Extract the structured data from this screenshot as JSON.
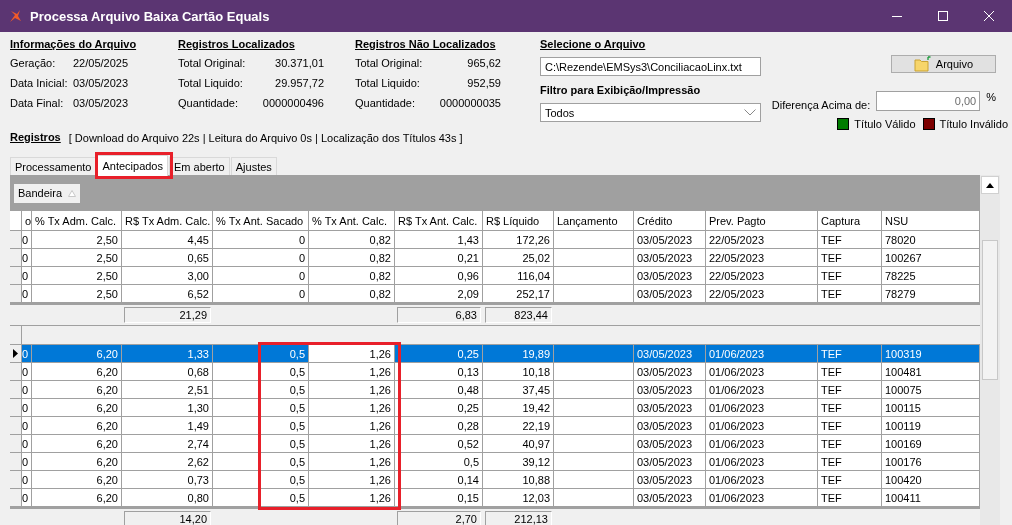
{
  "window": {
    "title": "Processa Arquivo Baixa Cartão Equals"
  },
  "file_info": {
    "heading": "Informações do Arquivo",
    "fields": [
      {
        "label": "Geração:",
        "value": "22/05/2025"
      },
      {
        "label": "Data Inicial:",
        "value": "03/05/2023"
      },
      {
        "label": "Data Final:",
        "value": "03/05/2023"
      }
    ]
  },
  "located": {
    "heading": "Registros Localizados",
    "fields": [
      {
        "label": "Total Original:",
        "value": "30.371,01"
      },
      {
        "label": "Total Liquido:",
        "value": "29.957,72"
      },
      {
        "label": "Quantidade:",
        "value": "0000000496"
      }
    ]
  },
  "not_located": {
    "heading": "Registros Não Localizados",
    "fields": [
      {
        "label": "Total Original:",
        "value": "965,62"
      },
      {
        "label": "Total Liquido:",
        "value": "952,59"
      },
      {
        "label": "Quantidade:",
        "value": "0000000035"
      }
    ]
  },
  "file_select": {
    "heading": "Selecione o Arquivo",
    "path": "C:\\Rezende\\EMSys3\\ConciliacaoLinx.txt",
    "button": "Arquivo"
  },
  "filter": {
    "heading": "Filtro para Exibição/Impressão",
    "value": "Todos"
  },
  "difference": {
    "label": "Diferença Acima de:",
    "value": "0,00",
    "unit": "%"
  },
  "legend": [
    {
      "label": "Título Válido",
      "color": "#007c00"
    },
    {
      "label": "Título Inválido",
      "color": "#7c0000"
    }
  ],
  "records": {
    "heading": "Registros",
    "timing": "[ Download do Arquivo 22s | Leitura do Arquivo 0s | Localização dos Títulos 43s ]"
  },
  "tabs": [
    {
      "label": "Processamento",
      "selected": false,
      "highlighted": false
    },
    {
      "label": "Antecipados",
      "selected": true,
      "highlighted": true
    },
    {
      "label": "Em aberto",
      "selected": false,
      "highlighted": false
    },
    {
      "label": "Ajustes",
      "selected": false,
      "highlighted": false
    }
  ],
  "group_by": {
    "label": "Bandeira"
  },
  "table": {
    "columns": [
      {
        "label": "o",
        "highlighted": false,
        "focused": false
      },
      {
        "label": "% Tx Adm. Calc.",
        "highlighted": false,
        "focused": false
      },
      {
        "label": "R$ Tx Adm. Calc.",
        "highlighted": false,
        "focused": false
      },
      {
        "label": "% Tx Ant. Sacado",
        "highlighted": true,
        "focused": false
      },
      {
        "label": "% Tx Ant. Calc.",
        "highlighted": true,
        "focused": true
      },
      {
        "label": "R$ Tx Ant. Calc.",
        "highlighted": false,
        "focused": false
      },
      {
        "label": "R$ Líquido",
        "highlighted": false,
        "focused": false
      },
      {
        "label": "Lançamento",
        "highlighted": false,
        "focused": false
      },
      {
        "label": "Crédito",
        "highlighted": false,
        "focused": false
      },
      {
        "label": "Prev. Pagto",
        "highlighted": false,
        "focused": false
      },
      {
        "label": "Captura",
        "highlighted": false,
        "focused": false
      },
      {
        "label": "NSU",
        "highlighted": false,
        "focused": false
      }
    ],
    "groups": [
      {
        "highlighted": false,
        "rows": [
          {
            "selected": false,
            "cells": {
              "column_0": "0",
              "column_1": "2,50",
              "column_2": "4,45",
              "column_3": "0",
              "column_4": "0,82",
              "column_5": "1,43",
              "column_6": "172,26",
              "column_8": "03/05/2023",
              "column_9": "22/05/2023",
              "column_10": "TEF",
              "column_11": "78020"
            }
          },
          {
            "selected": false,
            "cells": {
              "column_0": "0",
              "column_1": "2,50",
              "column_2": "0,65",
              "column_3": "0",
              "column_4": "0,82",
              "column_5": "0,21",
              "column_6": "25,02",
              "column_8": "03/05/2023",
              "column_9": "22/05/2023",
              "column_10": "TEF",
              "column_11": "100267"
            }
          },
          {
            "selected": false,
            "cells": {
              "column_0": "0",
              "column_1": "2,50",
              "column_2": "3,00",
              "column_3": "0",
              "column_4": "0,82",
              "column_5": "0,96",
              "column_6": "116,04",
              "column_8": "03/05/2023",
              "column_9": "22/05/2023",
              "column_10": "TEF",
              "column_11": "78225"
            }
          },
          {
            "selected": false,
            "cells": {
              "column_0": "0",
              "column_1": "2,50",
              "column_2": "6,52",
              "column_3": "0",
              "column_4": "0,82",
              "column_5": "2,09",
              "column_6": "252,17",
              "column_8": "03/05/2023",
              "column_9": "22/05/2023",
              "column_10": "TEF",
              "column_11": "78279"
            }
          }
        ],
        "totals": {
          "column_2": "21,29",
          "column_5": "6,83",
          "column_6": "823,44"
        }
      },
      {
        "highlighted": true,
        "rows": [
          {
            "selected": true,
            "cells": {
              "column_0": "0",
              "column_1": "6,20",
              "column_2": "1,33",
              "column_3": "0,5",
              "column_4": "1,26",
              "column_5": "0,25",
              "column_6": "19,89",
              "column_8": "03/05/2023",
              "column_9": "01/06/2023",
              "column_10": "TEF",
              "column_11": "100319"
            }
          },
          {
            "selected": false,
            "cells": {
              "column_0": "0",
              "column_1": "6,20",
              "column_2": "0,68",
              "column_3": "0,5",
              "column_4": "1,26",
              "column_5": "0,13",
              "column_6": "10,18",
              "column_8": "03/05/2023",
              "column_9": "01/06/2023",
              "column_10": "TEF",
              "column_11": "100481"
            }
          },
          {
            "selected": false,
            "cells": {
              "column_0": "0",
              "column_1": "6,20",
              "column_2": "2,51",
              "column_3": "0,5",
              "column_4": "1,26",
              "column_5": "0,48",
              "column_6": "37,45",
              "column_8": "03/05/2023",
              "column_9": "01/06/2023",
              "column_10": "TEF",
              "column_11": "100075"
            }
          },
          {
            "selected": false,
            "cells": {
              "column_0": "0",
              "column_1": "6,20",
              "column_2": "1,30",
              "column_3": "0,5",
              "column_4": "1,26",
              "column_5": "0,25",
              "column_6": "19,42",
              "column_8": "03/05/2023",
              "column_9": "01/06/2023",
              "column_10": "TEF",
              "column_11": "100115"
            }
          },
          {
            "selected": false,
            "cells": {
              "column_0": "0",
              "column_1": "6,20",
              "column_2": "1,49",
              "column_3": "0,5",
              "column_4": "1,26",
              "column_5": "0,28",
              "column_6": "22,19",
              "column_8": "03/05/2023",
              "column_9": "01/06/2023",
              "column_10": "TEF",
              "column_11": "100119"
            }
          },
          {
            "selected": false,
            "cells": {
              "column_0": "0",
              "column_1": "6,20",
              "column_2": "2,74",
              "column_3": "0,5",
              "column_4": "1,26",
              "column_5": "0,52",
              "column_6": "40,97",
              "column_8": "03/05/2023",
              "column_9": "01/06/2023",
              "column_10": "TEF",
              "column_11": "100169"
            }
          },
          {
            "selected": false,
            "cells": {
              "column_0": "0",
              "column_1": "6,20",
              "column_2": "2,62",
              "column_3": "0,5",
              "column_4": "1,26",
              "column_5": "0,5",
              "column_6": "39,12",
              "column_8": "03/05/2023",
              "column_9": "01/06/2023",
              "column_10": "TEF",
              "column_11": "100176"
            }
          },
          {
            "selected": false,
            "cells": {
              "column_0": "0",
              "column_1": "6,20",
              "column_2": "0,73",
              "column_3": "0,5",
              "column_4": "1,26",
              "column_5": "0,14",
              "column_6": "10,88",
              "column_8": "03/05/2023",
              "column_9": "01/06/2023",
              "column_10": "TEF",
              "column_11": "100420"
            }
          },
          {
            "selected": false,
            "cells": {
              "column_0": "0",
              "column_1": "6,20",
              "column_2": "0,80",
              "column_3": "0,5",
              "column_4": "1,26",
              "column_5": "0,15",
              "column_6": "12,03",
              "column_8": "03/05/2023",
              "column_9": "01/06/2023",
              "column_10": "TEF",
              "column_11": "100411"
            }
          }
        ],
        "totals": {
          "column_2": "14,20",
          "column_5": "2,70",
          "column_6": "212,13"
        }
      }
    ]
  }
}
